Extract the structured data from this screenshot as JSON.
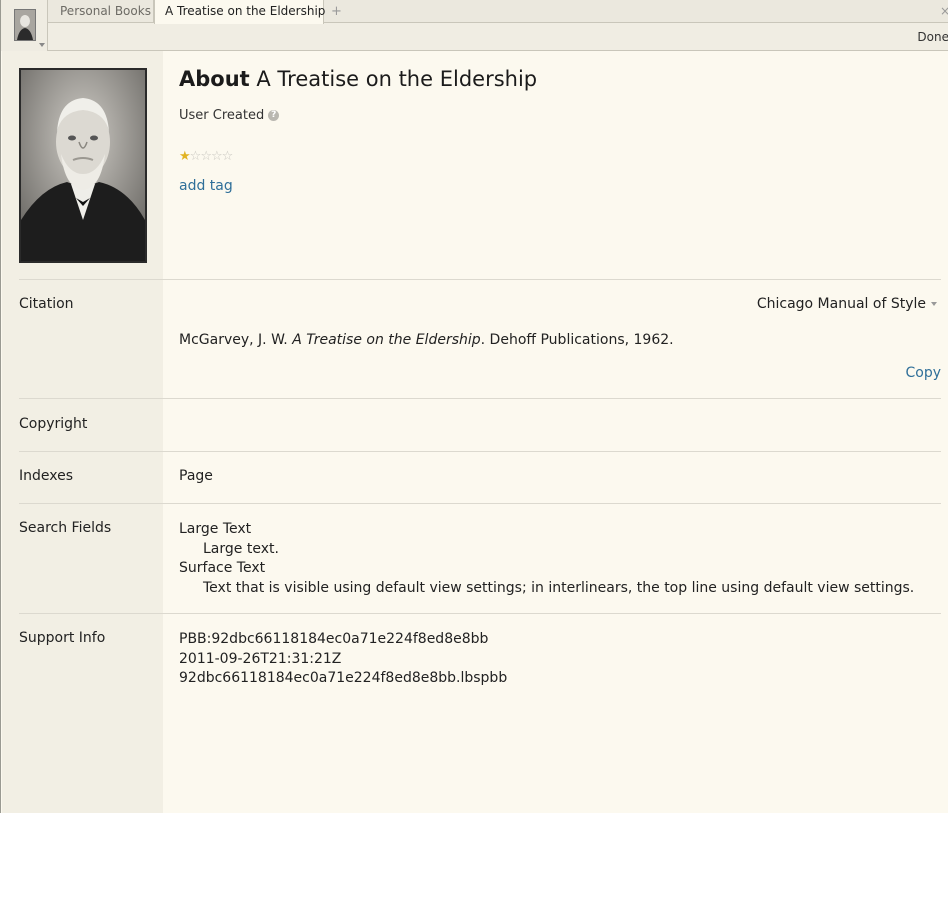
{
  "tabs": {
    "items": [
      {
        "label": "Personal Books"
      },
      {
        "label": "A Treatise on the Eldership"
      }
    ],
    "add_symbol": "+",
    "close_symbol": "×"
  },
  "toolbar": {
    "done_label": "Done"
  },
  "header": {
    "about_label": "About",
    "title": "A Treatise on the Eldership",
    "user_created": "User Created",
    "help_symbol": "?",
    "rating": {
      "value": 1,
      "max": 5
    },
    "add_tag_label": "add tag"
  },
  "colors": {
    "accent_link": "#2f6f99",
    "star_on": "#e1b323",
    "star_off": "#c9c7c0",
    "background": "#fcf9ef",
    "sidebar": "#f2efe4"
  },
  "citation": {
    "label": "Citation",
    "style": "Chicago Manual of Style",
    "author": "McGarvey, J. W. ",
    "book_title": "A Treatise on the Eldership",
    "publication": ". Dehoff Publications, 1962.",
    "copy_label": "Copy"
  },
  "copyright": {
    "label": "Copyright"
  },
  "indexes": {
    "label": "Indexes",
    "value": "Page"
  },
  "search_fields": {
    "label": "Search Fields",
    "items": [
      {
        "name": "Large Text",
        "description": "Large text."
      },
      {
        "name": "Surface Text",
        "description": "Text that is visible using default view settings; in interlinears, the top line using default view settings."
      }
    ]
  },
  "support_info": {
    "label": "Support Info",
    "lines": [
      "PBB:92dbc66118184ec0a71e224f8ed8e8bb",
      "2011-09-26T21:31:21Z",
      "92dbc66118184ec0a71e224f8ed8e8bb.lbspbb"
    ]
  }
}
